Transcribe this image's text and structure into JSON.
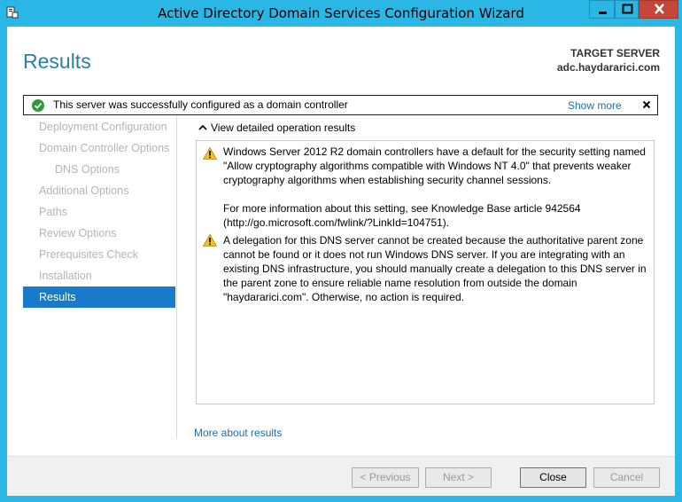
{
  "window": {
    "title": "Active Directory Domain Services Configuration Wizard",
    "accent_color": "#2ab7e6",
    "close_color": "#c7463b"
  },
  "page": {
    "heading": "Results",
    "target_label": "TARGET SERVER",
    "target_server": "adc.haydararici.com"
  },
  "banner": {
    "text": "This server was successfully configured as a domain controller",
    "show_more": "Show more",
    "icon": "success-check-icon"
  },
  "nav": {
    "items": [
      {
        "label": "Deployment Configuration"
      },
      {
        "label": "Domain Controller Options"
      },
      {
        "label": "DNS Options"
      },
      {
        "label": "Additional Options"
      },
      {
        "label": "Paths"
      },
      {
        "label": "Review Options"
      },
      {
        "label": "Prerequisites Check"
      },
      {
        "label": "Installation"
      },
      {
        "label": "Results"
      }
    ],
    "active_color": "#1979ca"
  },
  "details": {
    "toggle_label": "View detailed operation results",
    "messages": [
      {
        "icon": "warning-icon",
        "text": "Windows Server 2012 R2 domain controllers have a default for the security setting named \"Allow cryptography algorithms compatible with Windows NT 4.0\" that prevents weaker cryptography algorithms when establishing security channel sessions.",
        "extra": "For more information about this setting, see Knowledge Base article 942564 (http://go.microsoft.com/fwlink/?LinkId=104751)."
      },
      {
        "icon": "warning-icon",
        "text": "A delegation for this DNS server cannot be created because the authoritative parent zone cannot be found or it does not run Windows DNS server. If you are integrating with an existing DNS infrastructure, you should manually create a delegation to this DNS server in the parent zone to ensure reliable name resolution from outside the domain \"haydararici.com\". Otherwise, no action is required."
      }
    ]
  },
  "links": {
    "more_about_results": "More about results"
  },
  "footer": {
    "previous": "< Previous",
    "next": "Next >",
    "close": "Close",
    "cancel": "Cancel"
  }
}
